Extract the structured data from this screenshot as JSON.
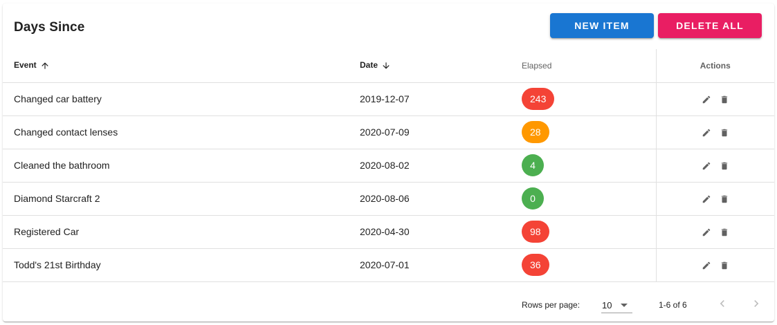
{
  "header": {
    "title": "Days Since",
    "new_item_label": "NEW ITEM",
    "delete_all_label": "DELETE ALL"
  },
  "table": {
    "columns": {
      "event": "Event",
      "date": "Date",
      "elapsed": "Elapsed",
      "actions": "Actions"
    },
    "rows": [
      {
        "event": "Changed car battery",
        "date": "2019-12-07",
        "elapsed": "243",
        "color": "#f44336"
      },
      {
        "event": "Changed contact lenses",
        "date": "2020-07-09",
        "elapsed": "28",
        "color": "#ff9800"
      },
      {
        "event": "Cleaned the bathroom",
        "date": "2020-08-02",
        "elapsed": "4",
        "color": "#4caf50"
      },
      {
        "event": "Diamond Starcraft 2",
        "date": "2020-08-06",
        "elapsed": "0",
        "color": "#4caf50"
      },
      {
        "event": "Registered Car",
        "date": "2020-04-30",
        "elapsed": "98",
        "color": "#f44336"
      },
      {
        "event": "Todd's 21st Birthday",
        "date": "2020-07-01",
        "elapsed": "36",
        "color": "#f44336"
      }
    ]
  },
  "footer": {
    "rows_per_page_label": "Rows per page:",
    "rows_per_page_value": "10",
    "range_text": "1-6 of 6"
  },
  "icons": {
    "sort_event": "arrow-up-icon",
    "sort_date": "arrow-down-icon",
    "edit": "pencil-icon",
    "delete": "trash-icon",
    "prev": "chevron-left-icon",
    "next": "chevron-right-icon"
  }
}
